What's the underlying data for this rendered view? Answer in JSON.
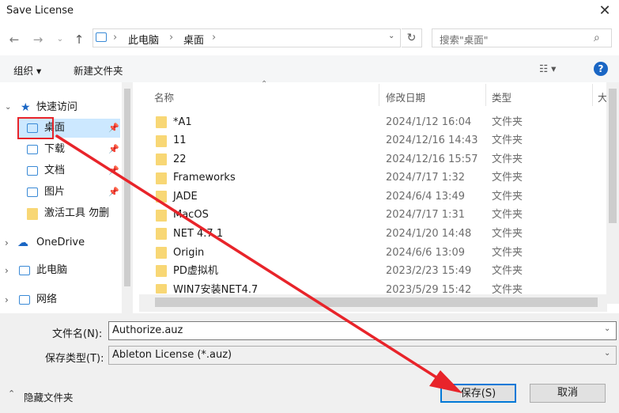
{
  "window": {
    "title": "Save License"
  },
  "nav": {
    "back_icon": "arrow-left-icon",
    "forward_icon": "arrow-right-icon",
    "history_icon": "chevron-down-icon",
    "up_icon": "arrow-up-icon",
    "breadcrumb": [
      "此电脑",
      "桌面"
    ],
    "search_placeholder": "搜索\"桌面\""
  },
  "toolbar": {
    "organize": "组织 ▾",
    "new_folder": "新建文件夹"
  },
  "sidebar": {
    "quick_access": "快速访问",
    "items": [
      {
        "label": "桌面",
        "pinned": true
      },
      {
        "label": "下载",
        "pinned": true
      },
      {
        "label": "文档",
        "pinned": true
      },
      {
        "label": "图片",
        "pinned": true
      },
      {
        "label": "激活工具 勿删",
        "pinned": false
      }
    ],
    "onedrive": "OneDrive",
    "this_pc": "此电脑",
    "network": "网络"
  },
  "columns": {
    "name": "名称",
    "modified": "修改日期",
    "type": "类型",
    "size": "大"
  },
  "files": [
    {
      "name": "*A1",
      "date": "2024/1/12 16:04",
      "type": "文件夹"
    },
    {
      "name": "11",
      "date": "2024/12/16 14:43",
      "type": "文件夹"
    },
    {
      "name": "22",
      "date": "2024/12/16 15:57",
      "type": "文件夹"
    },
    {
      "name": "Frameworks",
      "date": "2024/7/17 1:32",
      "type": "文件夹"
    },
    {
      "name": "JADE",
      "date": "2024/6/4 13:49",
      "type": "文件夹"
    },
    {
      "name": "MacOS",
      "date": "2024/7/17 1:31",
      "type": "文件夹"
    },
    {
      "name": "NET 4.7.1",
      "date": "2024/1/20 14:48",
      "type": "文件夹"
    },
    {
      "name": "Origin",
      "date": "2024/6/6 13:09",
      "type": "文件夹"
    },
    {
      "name": "PD虚拟机",
      "date": "2023/2/23 15:49",
      "type": "文件夹"
    },
    {
      "name": "WIN7安装NET4.7",
      "date": "2023/5/29 15:42",
      "type": "文件夹"
    }
  ],
  "form": {
    "filename_label": "文件名(N):",
    "filename_value": "Authorize.auz",
    "filetype_label": "保存类型(T):",
    "filetype_value": "Ableton License (*.auz)"
  },
  "footer": {
    "hide_folders": "隐藏文件夹",
    "save": "保存(S)",
    "cancel": "取消"
  },
  "colors": {
    "accent": "#1a66c4",
    "selected": "#cce8ff",
    "highlight": "#e8242a",
    "folder": "#f8d775"
  }
}
